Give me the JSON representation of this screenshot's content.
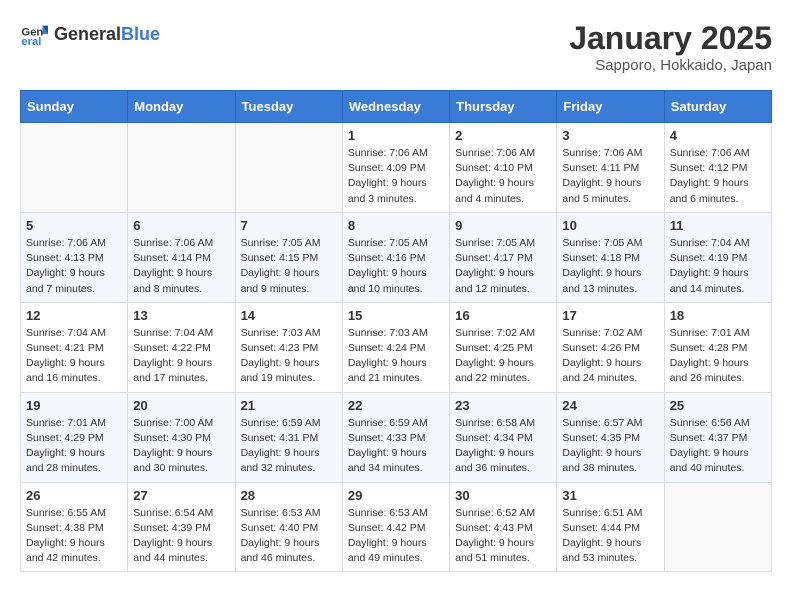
{
  "header": {
    "logo_general": "General",
    "logo_blue": "Blue",
    "month_title": "January 2025",
    "location": "Sapporo, Hokkaido, Japan"
  },
  "weekdays": [
    "Sunday",
    "Monday",
    "Tuesday",
    "Wednesday",
    "Thursday",
    "Friday",
    "Saturday"
  ],
  "weeks": [
    [
      {
        "day": "",
        "info": ""
      },
      {
        "day": "",
        "info": ""
      },
      {
        "day": "",
        "info": ""
      },
      {
        "day": "1",
        "info": "Sunrise: 7:06 AM\nSunset: 4:09 PM\nDaylight: 9 hours and 3 minutes."
      },
      {
        "day": "2",
        "info": "Sunrise: 7:06 AM\nSunset: 4:10 PM\nDaylight: 9 hours and 4 minutes."
      },
      {
        "day": "3",
        "info": "Sunrise: 7:06 AM\nSunset: 4:11 PM\nDaylight: 9 hours and 5 minutes."
      },
      {
        "day": "4",
        "info": "Sunrise: 7:06 AM\nSunset: 4:12 PM\nDaylight: 9 hours and 6 minutes."
      }
    ],
    [
      {
        "day": "5",
        "info": "Sunrise: 7:06 AM\nSunset: 4:13 PM\nDaylight: 9 hours and 7 minutes."
      },
      {
        "day": "6",
        "info": "Sunrise: 7:06 AM\nSunset: 4:14 PM\nDaylight: 9 hours and 8 minutes."
      },
      {
        "day": "7",
        "info": "Sunrise: 7:05 AM\nSunset: 4:15 PM\nDaylight: 9 hours and 9 minutes."
      },
      {
        "day": "8",
        "info": "Sunrise: 7:05 AM\nSunset: 4:16 PM\nDaylight: 9 hours and 10 minutes."
      },
      {
        "day": "9",
        "info": "Sunrise: 7:05 AM\nSunset: 4:17 PM\nDaylight: 9 hours and 12 minutes."
      },
      {
        "day": "10",
        "info": "Sunrise: 7:05 AM\nSunset: 4:18 PM\nDaylight: 9 hours and 13 minutes."
      },
      {
        "day": "11",
        "info": "Sunrise: 7:04 AM\nSunset: 4:19 PM\nDaylight: 9 hours and 14 minutes."
      }
    ],
    [
      {
        "day": "12",
        "info": "Sunrise: 7:04 AM\nSunset: 4:21 PM\nDaylight: 9 hours and 16 minutes."
      },
      {
        "day": "13",
        "info": "Sunrise: 7:04 AM\nSunset: 4:22 PM\nDaylight: 9 hours and 17 minutes."
      },
      {
        "day": "14",
        "info": "Sunrise: 7:03 AM\nSunset: 4:23 PM\nDaylight: 9 hours and 19 minutes."
      },
      {
        "day": "15",
        "info": "Sunrise: 7:03 AM\nSunset: 4:24 PM\nDaylight: 9 hours and 21 minutes."
      },
      {
        "day": "16",
        "info": "Sunrise: 7:02 AM\nSunset: 4:25 PM\nDaylight: 9 hours and 22 minutes."
      },
      {
        "day": "17",
        "info": "Sunrise: 7:02 AM\nSunset: 4:26 PM\nDaylight: 9 hours and 24 minutes."
      },
      {
        "day": "18",
        "info": "Sunrise: 7:01 AM\nSunset: 4:28 PM\nDaylight: 9 hours and 26 minutes."
      }
    ],
    [
      {
        "day": "19",
        "info": "Sunrise: 7:01 AM\nSunset: 4:29 PM\nDaylight: 9 hours and 28 minutes."
      },
      {
        "day": "20",
        "info": "Sunrise: 7:00 AM\nSunset: 4:30 PM\nDaylight: 9 hours and 30 minutes."
      },
      {
        "day": "21",
        "info": "Sunrise: 6:59 AM\nSunset: 4:31 PM\nDaylight: 9 hours and 32 minutes."
      },
      {
        "day": "22",
        "info": "Sunrise: 6:59 AM\nSunset: 4:33 PM\nDaylight: 9 hours and 34 minutes."
      },
      {
        "day": "23",
        "info": "Sunrise: 6:58 AM\nSunset: 4:34 PM\nDaylight: 9 hours and 36 minutes."
      },
      {
        "day": "24",
        "info": "Sunrise: 6:57 AM\nSunset: 4:35 PM\nDaylight: 9 hours and 38 minutes."
      },
      {
        "day": "25",
        "info": "Sunrise: 6:56 AM\nSunset: 4:37 PM\nDaylight: 9 hours and 40 minutes."
      }
    ],
    [
      {
        "day": "26",
        "info": "Sunrise: 6:55 AM\nSunset: 4:38 PM\nDaylight: 9 hours and 42 minutes."
      },
      {
        "day": "27",
        "info": "Sunrise: 6:54 AM\nSunset: 4:39 PM\nDaylight: 9 hours and 44 minutes."
      },
      {
        "day": "28",
        "info": "Sunrise: 6:53 AM\nSunset: 4:40 PM\nDaylight: 9 hours and 46 minutes."
      },
      {
        "day": "29",
        "info": "Sunrise: 6:53 AM\nSunset: 4:42 PM\nDaylight: 9 hours and 49 minutes."
      },
      {
        "day": "30",
        "info": "Sunrise: 6:52 AM\nSunset: 4:43 PM\nDaylight: 9 hours and 51 minutes."
      },
      {
        "day": "31",
        "info": "Sunrise: 6:51 AM\nSunset: 4:44 PM\nDaylight: 9 hours and 53 minutes."
      },
      {
        "day": "",
        "info": ""
      }
    ]
  ]
}
